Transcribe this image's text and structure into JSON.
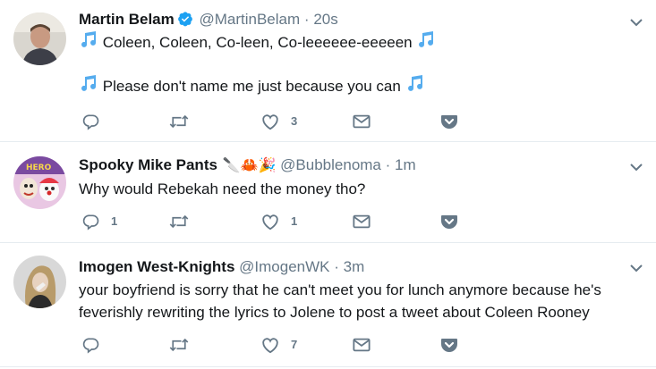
{
  "tweets": [
    {
      "name": "Martin Belam",
      "verified": true,
      "handle": "@MartinBelam",
      "separator": "·",
      "time": "20s",
      "text_lines": [
        "Coleen, Coleen, Co-leen, Co-leeeeee-eeeeen",
        "Please don't name me just because you can"
      ],
      "note_icon": "music-notes-icon",
      "reply_count": "",
      "retweet_count": "",
      "like_count": "3"
    },
    {
      "name": "Spooky Mike Pants",
      "name_emoji": "🔪🦀🎉",
      "handle": "@Bubblenoma",
      "separator": "·",
      "time": "1m",
      "text": "Why would Rebekah need the money tho?",
      "reply_count": "1",
      "retweet_count": "",
      "like_count": "1"
    },
    {
      "name": "Imogen West-Knights",
      "handle": "@ImogenWK",
      "separator": "·",
      "time": "3m",
      "text_lines": [
        "your boyfriend is sorry that he can't meet you for lunch anymore because he's",
        "feverishly rewriting the lyrics to Jolene to post a tweet about Coleen Rooney"
      ],
      "reply_count": "",
      "retweet_count": "",
      "like_count": "7"
    }
  ],
  "colors": {
    "icon": "#657786",
    "accent": "#1da1f2",
    "note": "#55acee",
    "divider": "#e6ecf0"
  }
}
